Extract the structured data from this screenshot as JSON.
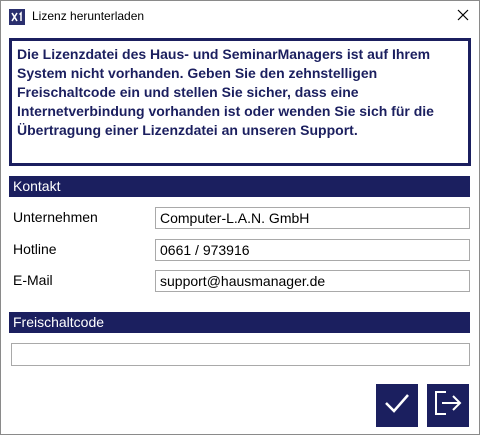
{
  "window": {
    "title": "Lizenz herunterladen",
    "app_icon": "x1-app-icon",
    "close_icon": "close-icon"
  },
  "info": {
    "message": "Die Lizenzdatei des Haus- und SeminarManagers ist auf Ihrem System nicht vorhanden. Geben Sie den zehnstelligen Freischaltcode ein und stellen Sie sicher, dass eine Internetverbindung vorhanden ist oder wenden Sie sich für die Übertragung einer Lizenzdatei an unseren Support."
  },
  "contact": {
    "header": "Kontakt",
    "fields": [
      {
        "label": "Unternehmen",
        "value": "Computer-L.A.N. GmbH"
      },
      {
        "label": "Hotline",
        "value": "0661 / 973916"
      },
      {
        "label": "E-Mail",
        "value": "support@hausmanager.de"
      }
    ]
  },
  "activation": {
    "header": "Freischaltcode",
    "value": ""
  },
  "actions": {
    "confirm_icon": "checkmark-icon",
    "exit_icon": "exit-icon"
  },
  "colors": {
    "accent": "#1b1f5f",
    "border": "#a9a9a9"
  }
}
